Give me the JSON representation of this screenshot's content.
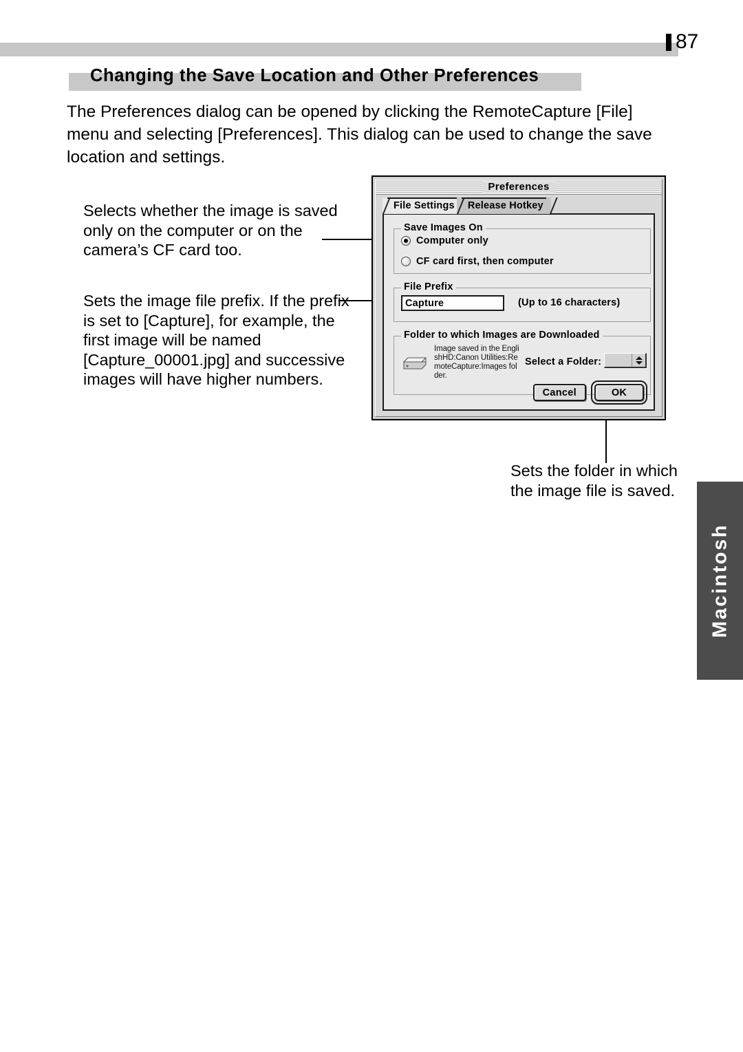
{
  "page": {
    "number": "87",
    "side_tab_label": "Macintosh"
  },
  "heading": {
    "title": "Changing the Save Location and Other Preferences"
  },
  "intro": {
    "paragraph": "The Preferences dialog can be opened by clicking the RemoteCapture [File] menu and selecting [Preferences]. This dialog can be used to change the save location and settings."
  },
  "annotations": {
    "save_location": "Selects whether the image is saved only on the computer or on the camera’s CF card too.",
    "file_prefix": "Sets the image file prefix. If the prefix is set to [Capture], for example, the first image will be named [Capture_00001.jpg] and successive images will have higher numbers.",
    "folder": "Sets the folder in which the image file is saved."
  },
  "dialog": {
    "title": "Preferences",
    "tabs": [
      {
        "label": "File Settings",
        "active": true
      },
      {
        "label": "Release Hotkey",
        "active": false
      }
    ],
    "save_images_on": {
      "group_label": "Save Images On",
      "options": [
        {
          "label": "Computer only",
          "selected": true
        },
        {
          "label": "CF card first, then computer",
          "selected": false
        }
      ]
    },
    "file_prefix": {
      "group_label": "File Prefix",
      "value": "Capture",
      "placeholder": "",
      "hint": "(Up to 16 characters)"
    },
    "folder_section": {
      "group_label": "Folder to which Images are Downloaded",
      "path_description": "Image saved in the EnglishHD:Canon Utilities:RemoteCapture:Images folder.",
      "select_label": "Select a Folder:",
      "popup_value": ""
    },
    "buttons": {
      "cancel": "Cancel",
      "ok": "OK"
    }
  },
  "colors": {
    "header_bar": "#c6c6c6",
    "heading_band": "#c8c8c8",
    "side_tab": "#4c4c4c",
    "dialog_face": "#d8d8d8",
    "panel_face": "#e9e9e9"
  }
}
